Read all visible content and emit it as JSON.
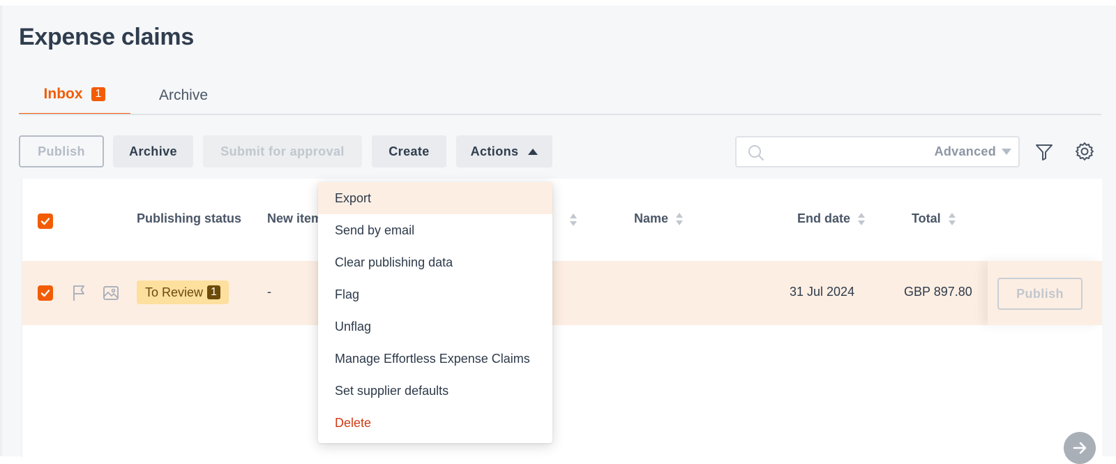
{
  "page": {
    "title": "Expense claims"
  },
  "tabs": [
    {
      "label": "Inbox",
      "badge": "1",
      "active": true
    },
    {
      "label": "Archive",
      "active": false
    }
  ],
  "toolbar": {
    "publish": "Publish",
    "archive": "Archive",
    "submit": "Submit for approval",
    "create": "Create",
    "actions": "Actions"
  },
  "search": {
    "placeholder": "",
    "advanced": "Advanced"
  },
  "table": {
    "columns": [
      "Publishing status",
      "New items",
      "Name",
      "End date",
      "Total"
    ],
    "rows": [
      {
        "checked": true,
        "status": "To Review",
        "status_count": "1",
        "new_items": "-",
        "end_date": "31 Jul 2024",
        "total": "GBP 897.80",
        "action": "Publish"
      }
    ]
  },
  "actions_menu": {
    "items": [
      "Export",
      "Send by email",
      "Clear publishing data",
      "Flag",
      "Unflag",
      "Manage Effortless Expense Claims",
      "Set supplier defaults",
      "Delete"
    ],
    "highlighted": "Export",
    "danger": "Delete"
  },
  "colors": {
    "accent": "#f25c05",
    "row_highlight": "#fdeee3",
    "status_badge": "#fddf9e",
    "danger": "#d13b14"
  },
  "icons": [
    "search-icon",
    "filter-icon",
    "gear-icon",
    "flag-icon",
    "image-icon",
    "sort-icon",
    "arrow-right-icon",
    "checkmark-icon",
    "caret-up-icon",
    "caret-down-icon"
  ]
}
